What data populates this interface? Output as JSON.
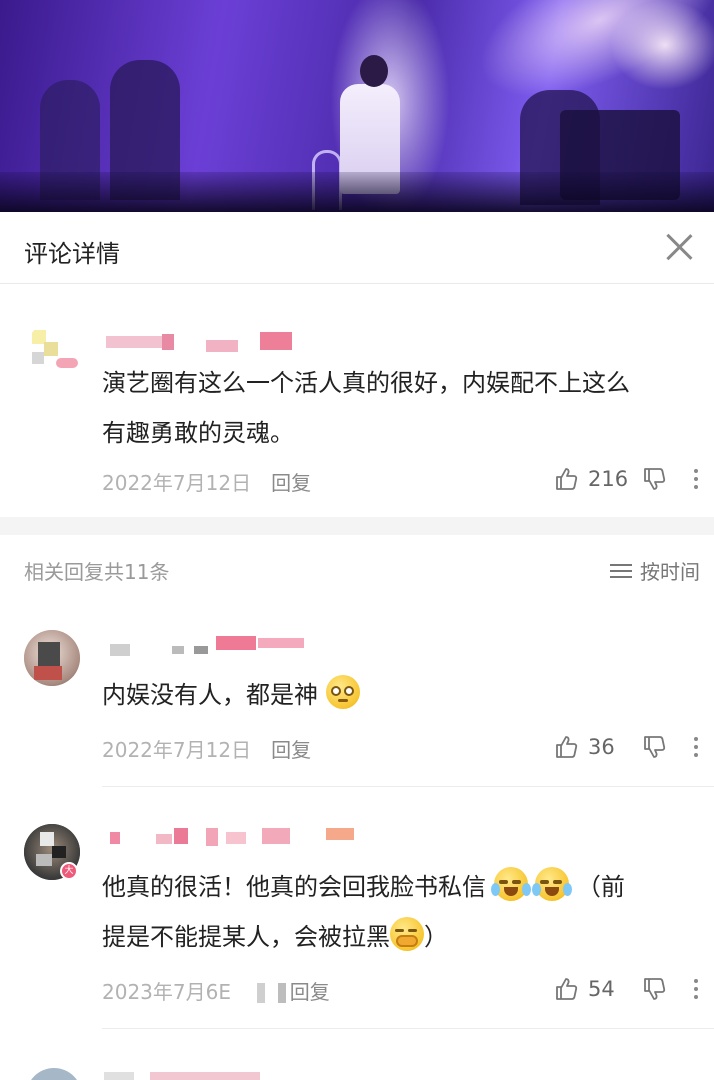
{
  "header": {
    "title": "评论详情"
  },
  "main_comment": {
    "text_lines": [
      "演艺圈有这么一个活人真的很好，内娱配不上这么",
      "有趣勇敢的灵魂。"
    ],
    "date": "2022年7月12日",
    "reply_label": "回复",
    "likes": "216"
  },
  "replies_section": {
    "count_label": "相关回复共11条",
    "sort_label": "按时间"
  },
  "replies": [
    {
      "text": "内娱没有人，都是神",
      "date": "2022年7月12日",
      "reply_label": "回复",
      "likes": "36"
    },
    {
      "text_line1": "他真的很活！他真的会回我脸书私信",
      "text_line1_tail": "（前",
      "text_line2": "提是不能提某人，会被拉黑",
      "text_line2_tail": "）",
      "date": "2023年7月6E",
      "reply_label": "回复",
      "likes": "54"
    }
  ],
  "colors": {
    "accent_pink": "#f06a8a",
    "text": "#222222",
    "muted": "#b2b2b2"
  }
}
